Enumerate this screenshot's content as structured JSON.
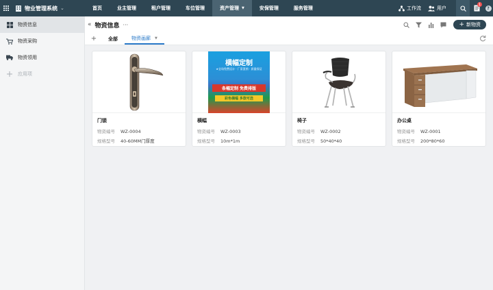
{
  "app": {
    "name": "物业管理系统",
    "brand_caret": "⌄"
  },
  "nav": {
    "items": [
      {
        "label": "首页"
      },
      {
        "label": "业主管理"
      },
      {
        "label": "租户管理"
      },
      {
        "label": "车位管理"
      },
      {
        "label": "资产管理",
        "active": true,
        "caret": "▼"
      },
      {
        "label": "安保管理"
      },
      {
        "label": "服务管理"
      }
    ]
  },
  "top_right": {
    "workflow_label": "工作流",
    "user_label": "用户",
    "message_badge": "1",
    "help_glyph": "?"
  },
  "sidebar": {
    "items": [
      {
        "label": "物资信息",
        "icon": "grid-icon",
        "active": true
      },
      {
        "label": "物资采购",
        "icon": "cart-icon"
      },
      {
        "label": "物资领用",
        "icon": "truck-icon"
      },
      {
        "label": "应用项",
        "icon": "plus-icon",
        "muted": true
      }
    ]
  },
  "header": {
    "collapse_glyph": "«",
    "title": "物资信息",
    "more_glyph": "···",
    "new_button_plus": "+",
    "new_button_label": "新物资"
  },
  "tabs": {
    "add_glyph": "+",
    "items": [
      {
        "label": "全部"
      },
      {
        "label": "物资画廊",
        "active": true,
        "caret": "▼"
      }
    ]
  },
  "cards": [
    {
      "title": "门锁",
      "id_key": "物资编号",
      "id": "WZ-0004",
      "spec_key": "规格型号",
      "spec": "40-60MM门厚度",
      "image": "door-lock"
    },
    {
      "title": "横幅",
      "id_key": "物资编号",
      "id": "WZ-0003",
      "spec_key": "规格型号",
      "spec": "10m*1m",
      "image": "banner"
    },
    {
      "title": "椅子",
      "id_key": "物资编号",
      "id": "WZ-0002",
      "spec_key": "规格型号",
      "spec": "50*40*40",
      "image": "chair"
    },
    {
      "title": "办公桌",
      "id_key": "物资编号",
      "id": "WZ-0001",
      "spec_key": "规格型号",
      "spec": "200*80*60",
      "image": "desk"
    }
  ],
  "banner_image": {
    "headline": "横幅定制",
    "subline": "★全场免费设计 · 厂家直销 · 质量保证",
    "ribbon": "条幅定制 免费排版",
    "ribbon2": "彩色横幅 多款可选"
  },
  "colors": {
    "topbar": "#2e4653",
    "accent": "#2979c8",
    "badge": "#f05050"
  }
}
